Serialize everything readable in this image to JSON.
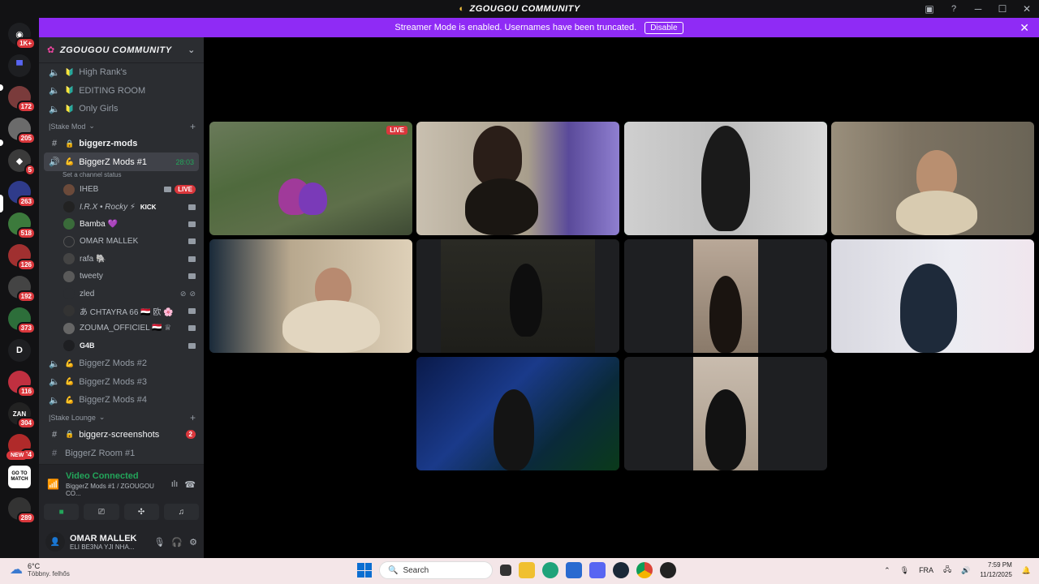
{
  "app": {
    "title": "ZGOUGOU COMMUNITY"
  },
  "banner": {
    "text": "Streamer Mode is enabled. Usernames have been truncated.",
    "disable_label": "Disable"
  },
  "servers": [
    {
      "label": "1K+",
      "color": "#5865f2"
    },
    {
      "label": "",
      "color": "#5865f2"
    },
    {
      "label": "172",
      "color": "#7a3b3b"
    },
    {
      "label": "205",
      "color": "#6b6b6b"
    },
    {
      "label": "5",
      "color": "#3a3a3a"
    },
    {
      "label": "263",
      "color": "#2f3b8a"
    },
    {
      "label": "518",
      "color": "#3c7a3c"
    },
    {
      "label": "126",
      "color": "#a03030"
    },
    {
      "label": "192",
      "color": "#444"
    },
    {
      "label": "373",
      "color": "#2d6e3a"
    },
    {
      "label": "D",
      "color": "#1e1f22"
    },
    {
      "label": "116",
      "color": "#c03040"
    },
    {
      "label": "304",
      "color": "#222"
    },
    {
      "label": "64",
      "color": "#b02a2a"
    },
    {
      "label": "",
      "color": "#ffffff"
    },
    {
      "label": "289",
      "color": "#333"
    }
  ],
  "servers_new": "NEW",
  "server_d_label": "D",
  "server_gotomatch": "GO TO MATCH",
  "server_zan": "ZAN",
  "guild": {
    "name": "ZGOUGOU COMMUNITY"
  },
  "channels_top": [
    {
      "name": "High Rank's"
    },
    {
      "name": "EDITING ROOM"
    },
    {
      "name": "Only Girls"
    }
  ],
  "category1": "|Stake Mod",
  "text_channel1": "biggerz-mods",
  "active_channel": {
    "name": "BiggerZ Mods #1",
    "time": "28:03",
    "status": "Set a channel status"
  },
  "voice_users": [
    {
      "name": "IHEB",
      "live": "LIVE"
    },
    {
      "name": "I.R.X • Rocky ⚡",
      "tag": "KICK"
    },
    {
      "name": "Bamba 💜"
    },
    {
      "name": "OMAR MALLEK"
    },
    {
      "name": "rafa 🐘"
    },
    {
      "name": "tweety"
    },
    {
      "name": "zled"
    },
    {
      "name": "あ CHTAYRA 66 🇾🇪 欧 🌸"
    },
    {
      "name": "ZOUMA_OFFICIEL 🇾🇪 ♕"
    },
    {
      "name": "G4B"
    }
  ],
  "channels_after": [
    {
      "name": "BiggerZ Mods #2"
    },
    {
      "name": "BiggerZ Mods #3"
    },
    {
      "name": "BiggerZ Mods #4"
    }
  ],
  "category2": "|Stake Lounge",
  "text_channel2": {
    "name": "biggerz-screenshots",
    "unread": "2"
  },
  "partial_channel": "BiggerZ Room #1",
  "voice_panel": {
    "status": "Video Connected",
    "location": "BiggerZ Mods #1 / ZGOUGOU CO..."
  },
  "me": {
    "name": "OMAR MALLEK",
    "status": "ELI BE3NA YJI NHA..."
  },
  "stage": {
    "live_label": "LIVE"
  },
  "taskbar": {
    "temp": "6°C",
    "weather": "Többny. felhős",
    "search": "Search",
    "lang": "FRA",
    "time": "7:59 PM",
    "date": "11/12/2025"
  }
}
